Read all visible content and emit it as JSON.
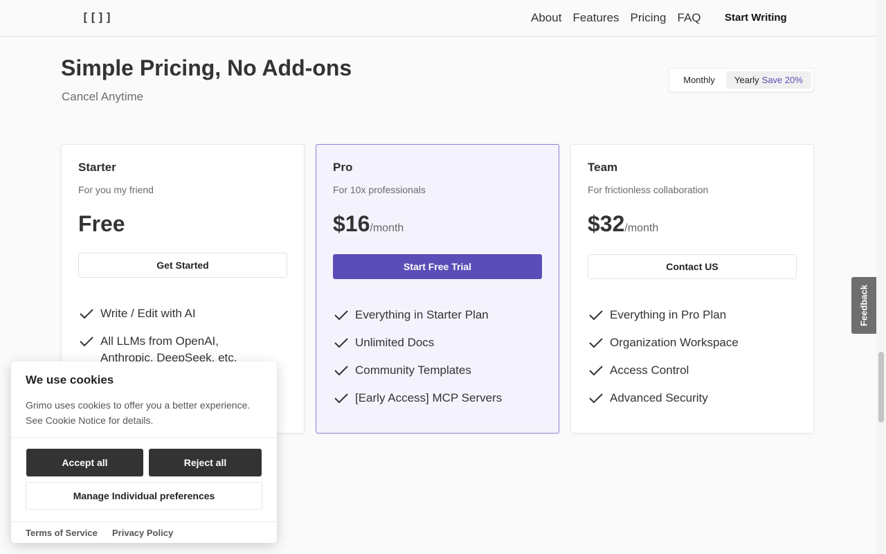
{
  "nav": {
    "logo": "[[]]",
    "links": [
      "About",
      "Features",
      "Pricing",
      "FAQ"
    ],
    "cta": "Start Writing"
  },
  "hero": {
    "title": "Simple Pricing, No Add-ons",
    "subtitle": "Cancel Anytime"
  },
  "billing_toggle": {
    "monthly": "Monthly",
    "yearly": "Yearly",
    "save_badge": "Save 20%",
    "selected": "Yearly"
  },
  "plans": [
    {
      "name": "Starter",
      "desc": "For you my friend",
      "price": "Free",
      "per": "",
      "cta": "Get Started",
      "features": [
        "Write / Edit with AI",
        "All LLMs from OpenAI, Anthropic, DeepSeek, etc."
      ]
    },
    {
      "name": "Pro",
      "desc": "For 10x professionals",
      "price": "$16",
      "per": "/month",
      "cta": "Start Free Trial",
      "features": [
        "Everything in Starter Plan",
        "Unlimited Docs",
        "Community Templates",
        "[Early Access] MCP Servers"
      ]
    },
    {
      "name": "Team",
      "desc": "For frictionless collaboration",
      "price": "$32",
      "per": "/month",
      "cta": "Contact US",
      "features": [
        "Everything in Pro Plan",
        "Organization Workspace",
        "Access Control",
        "Advanced Security"
      ]
    }
  ],
  "feedback": {
    "label": "Feedback"
  },
  "cookie": {
    "title": "We use cookies",
    "text": "Grimo uses cookies to offer you a better experience. See Cookie Notice for details.",
    "accept": "Accept all",
    "reject": "Reject all",
    "manage": "Manage Individual preferences",
    "terms": "Terms of Service",
    "privacy": "Privacy Policy"
  },
  "colors": {
    "accent": "#5b4db7",
    "pro_bg": "#f4f3fd",
    "dark_button": "#333333"
  }
}
